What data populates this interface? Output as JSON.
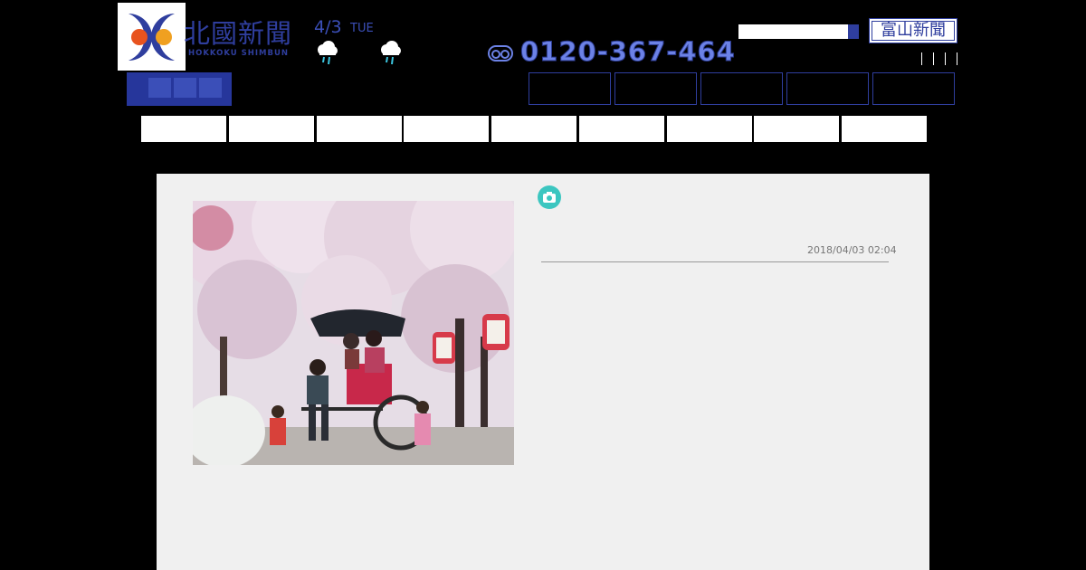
{
  "header": {
    "logo_ja": "北國新聞",
    "logo_en": "HOKKOKU SHIMBUN",
    "date": "4/3",
    "weekday": "TUE",
    "weather_icons": [
      "rain-cloud-icon",
      "rain-cloud-icon"
    ],
    "phone": "0120-367-464",
    "phone_icon": "free-dial-icon",
    "search": {
      "value": "",
      "placeholder": ""
    },
    "toyama_link": "富山新聞"
  },
  "article": {
    "photo_icon": "camera-icon",
    "timestamp": "2018/04/03 02:04"
  },
  "colors": {
    "brand_blue": "#2f3e9e",
    "accent_teal": "#3cc6c0",
    "content_bg": "#f0f0f0"
  }
}
